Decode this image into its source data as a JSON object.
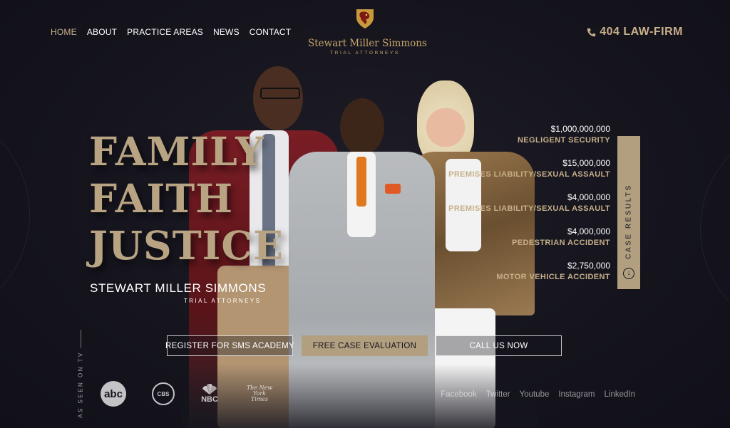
{
  "nav": {
    "items": [
      {
        "label": "HOME",
        "active": true
      },
      {
        "label": "ABOUT",
        "active": false
      },
      {
        "label": "PRACTICE AREAS",
        "active": false
      },
      {
        "label": "NEWS",
        "active": false
      },
      {
        "label": "CONTACT",
        "active": false
      }
    ]
  },
  "logo": {
    "name": "Stewart Miller Simmons",
    "sub": "TRIAL ATTORNEYS",
    "icon": "lion-shield-icon"
  },
  "phone": {
    "label": "404 LAW-FIRM",
    "icon": "phone-icon"
  },
  "hero": {
    "line1": "FAMILY",
    "line2": "FAITH",
    "line3": "JUSTICE",
    "firm_name": "STEWART MILLER SIMMONS",
    "firm_sub": "TRIAL ATTORNEYS"
  },
  "results": [
    {
      "amount": "$1,000,000,000",
      "category": "NEGLIGENT SECURITY"
    },
    {
      "amount": "$15,000,000",
      "category": "PREMISES LIABILITY/SEXUAL ASSAULT"
    },
    {
      "amount": "$4,000,000",
      "category": "PREMISES LIABILITY/SEXUAL ASSAULT"
    },
    {
      "amount": "$4,000,000",
      "category": "PEDESTRIAN ACCIDENT"
    },
    {
      "amount": "$2,750,000",
      "category": "MOTOR VEHICLE ACCIDENT"
    }
  ],
  "case_results_tab": {
    "label": "CASE RESULTS",
    "icon": "arrow-down-circle-icon"
  },
  "buttons": {
    "register": "REGISTER FOR SMS ACADEMY",
    "evaluation": "FREE CASE EVALUATION",
    "call": "CALL US NOW"
  },
  "tv": {
    "label": "AS SEEN ON TV",
    "logos": {
      "abc": "abc",
      "cbs": "CBS",
      "nbc": "NBC",
      "nyt": "The New York Times"
    }
  },
  "social": [
    "Facebook",
    "Twitter",
    "Youtube",
    "Instagram",
    "LinkedIn"
  ],
  "colors": {
    "background": "#15141d",
    "accent": "#b19f80",
    "gold": "#c7a66a"
  }
}
